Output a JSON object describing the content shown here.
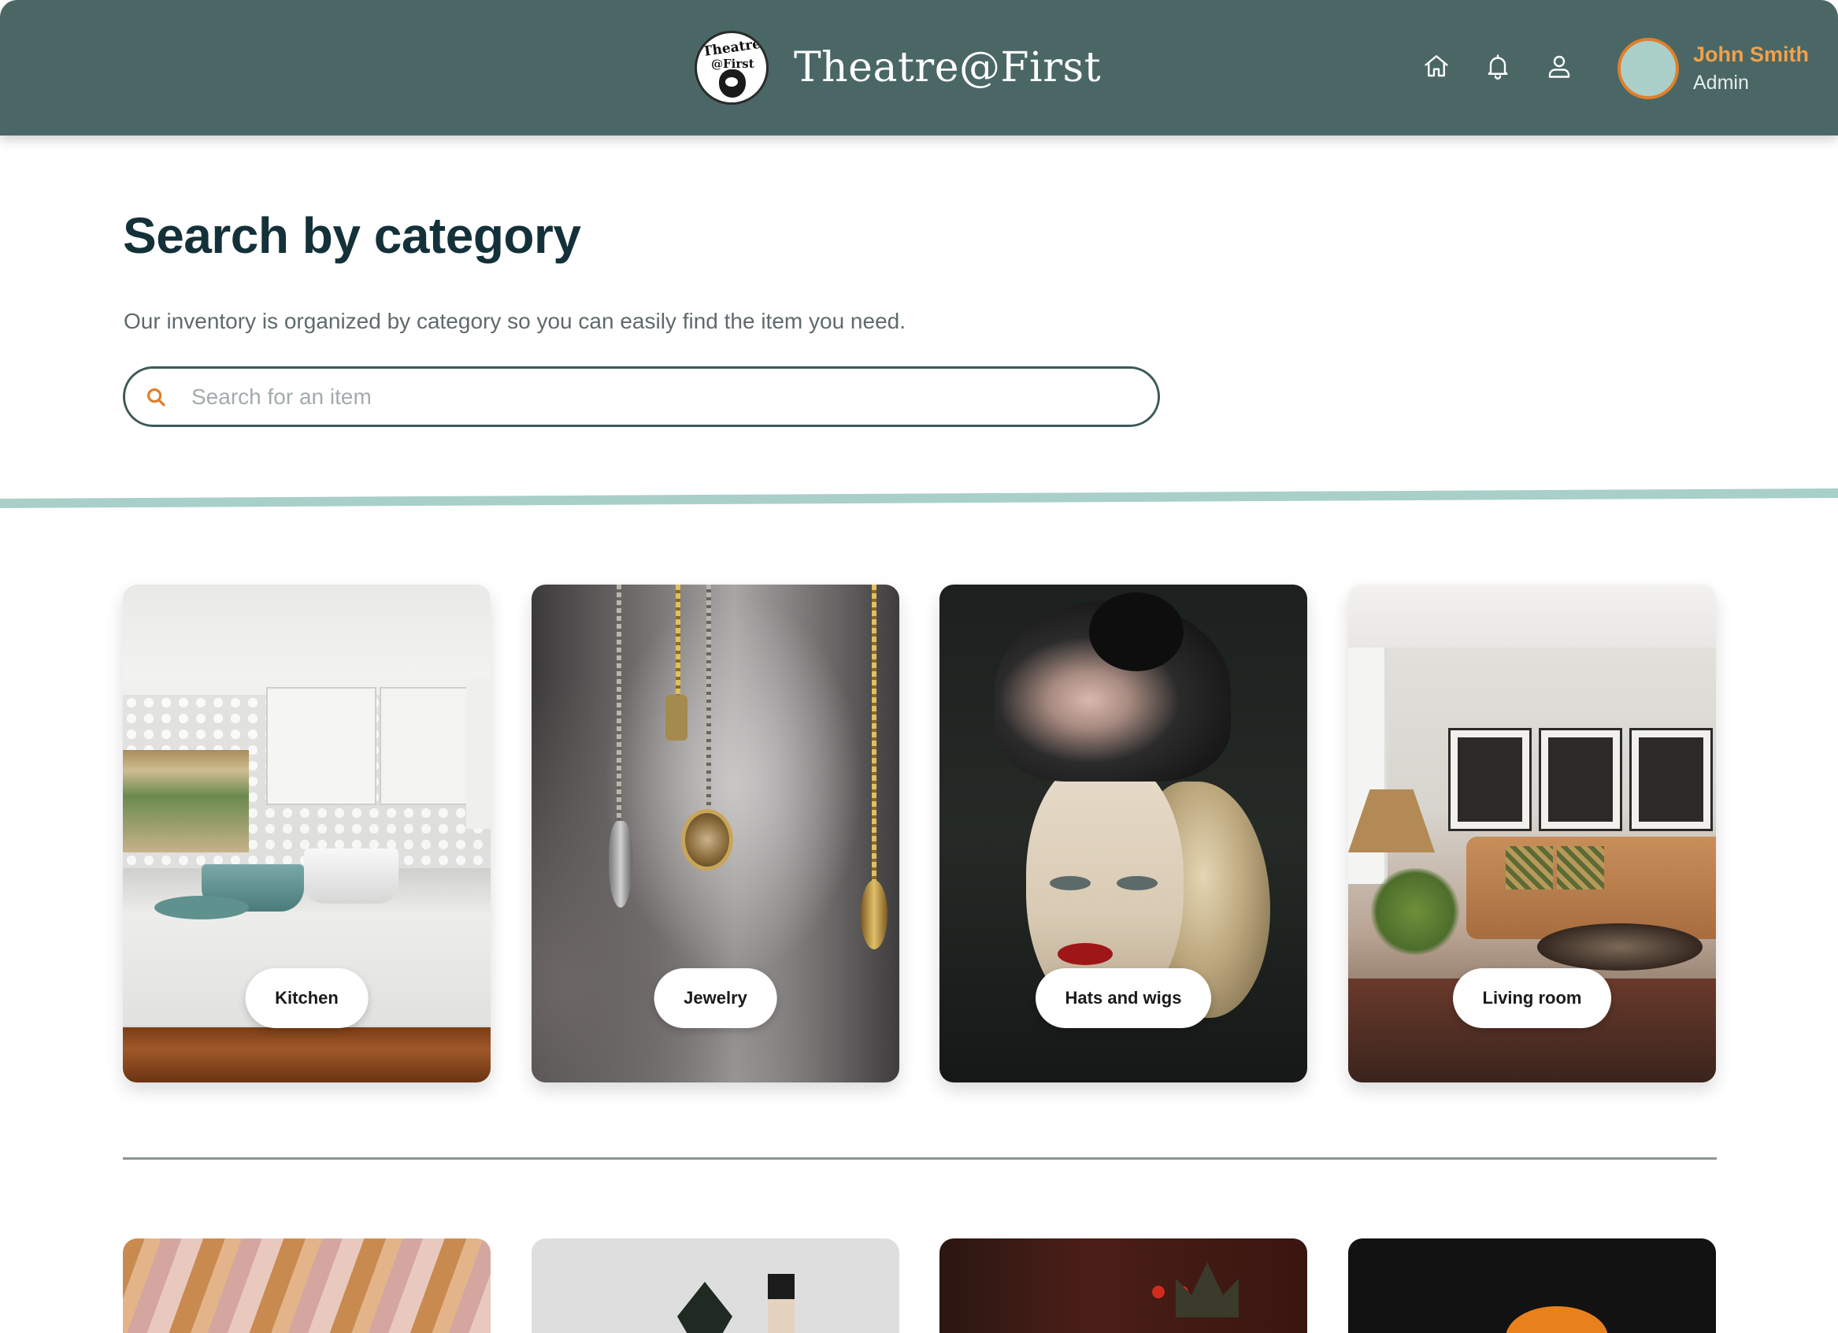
{
  "header": {
    "logo_alt": "Theatre @ First logo",
    "logo_top": "Theatre",
    "logo_mid": "@First",
    "brand_name": "Theatre@First",
    "nav": {
      "home_icon": "home-icon",
      "notifications_icon": "bell-icon",
      "profile_icon": "user-icon"
    },
    "user": {
      "name": "John Smith",
      "role": "Admin"
    }
  },
  "main": {
    "title": "Search by category",
    "subtitle": "Our inventory is organized by category so you can easily find the item you need.",
    "search": {
      "placeholder": "Search for an item",
      "value": "",
      "icon": "search-icon"
    }
  },
  "categories": [
    {
      "label": "Kitchen"
    },
    {
      "label": "Jewelry"
    },
    {
      "label": "Hats and wigs"
    },
    {
      "label": "Living room"
    }
  ],
  "colors": {
    "header_bg": "#4a6766",
    "accent_orange": "#e07f2a",
    "user_name": "#f2a14b",
    "title": "#14313a",
    "divider": "#a9cfc9"
  }
}
